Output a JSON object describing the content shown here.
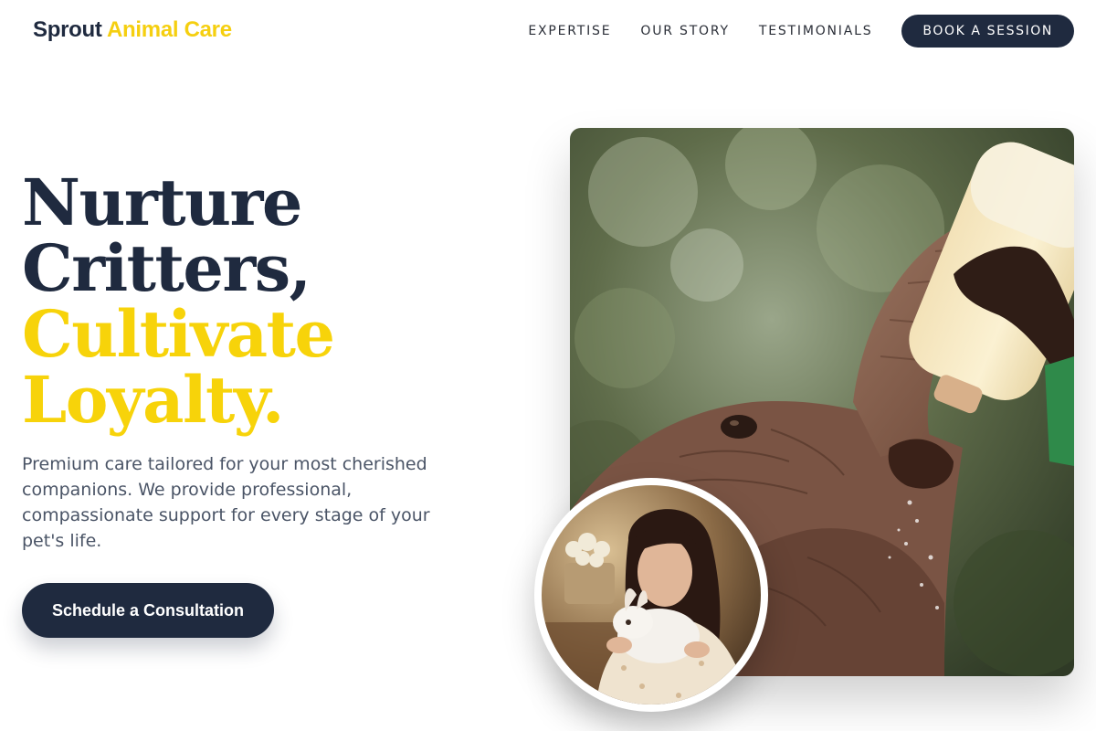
{
  "brand": {
    "name_primary": "Sprout",
    "name_accent": "Animal Care",
    "colors": {
      "navy": "#1f2a3f",
      "yellow": "#f7d30a",
      "body_text": "#4a5466"
    }
  },
  "nav": {
    "links": [
      "EXPERTISE",
      "OUR STORY",
      "TESTIMONIALS"
    ],
    "cta": "BOOK A SESSION"
  },
  "hero": {
    "headline_dark": [
      "Nurture",
      "Critters,"
    ],
    "headline_accent": [
      "Cultivate",
      "Loyalty."
    ],
    "description": "Premium care tailored for your most cherished companions. We provide professional, compassionate support for every stage of your pet's life.",
    "cta": "Schedule a Consultation"
  },
  "images": {
    "main": "baby-elephant-bottle-feeding-photo",
    "inset": "woman-holding-rabbit-photo"
  }
}
